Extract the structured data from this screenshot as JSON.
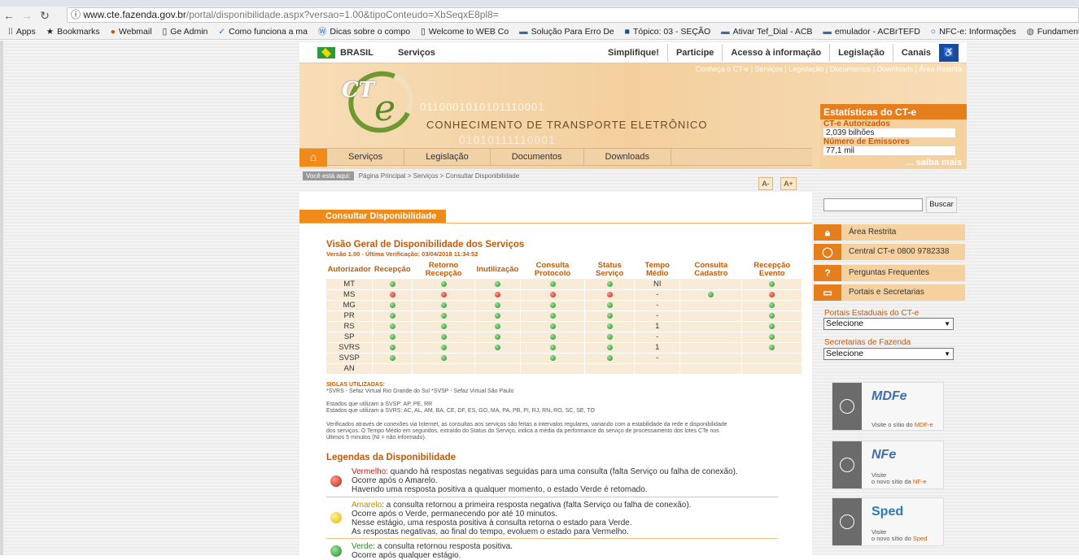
{
  "browser": {
    "url_host": "www.cte.fazenda.gov.br",
    "url_path": "/portal/disponibilidade.aspx?versao=1.00&tipoConteudo=XbSeqxE8pl8=",
    "bookmarks": [
      "Apps",
      "Bookmarks",
      "Webmail",
      "Ge Admin",
      "Como funciona a ma",
      "Dicas sobre o compo",
      "Welcome to WEB Co",
      "Solução Para Erro De",
      "Tópico: 03 - SEÇÃO",
      "Ativar Tef_Dial - ACB",
      "emulador - ACBrTEFD",
      "NFC-e: Informações",
      "Fundament"
    ]
  },
  "gov_bar": {
    "brasil": "BRASIL",
    "servicos": "Serviços",
    "items": [
      "Simplifique!",
      "Participe",
      "Acesso à informação",
      "Legislação",
      "Canais"
    ]
  },
  "header": {
    "top_links": "Conheça o CT-e | Serviços | Legislação | Documentos | Downloads | Área Restrita",
    "logo_ct": "CT",
    "logo_e": "e",
    "binary1": "0110001010101110001",
    "binary2": "01010111110001",
    "title": "CONHECIMENTO DE TRANSPORTE ELETRÔNICO"
  },
  "menu": [
    "Serviços",
    "Legislação",
    "Documentos",
    "Downloads"
  ],
  "stats": {
    "title": "Estatísticas do CT-e",
    "k1": "CT-e Autorizados",
    "v1": "2,039 bilhões",
    "k2": "Número de Emissores",
    "v2": "77,1 mil",
    "more": "... saiba mais"
  },
  "breadcrumb": {
    "label": "Você está aqui:",
    "path": "Página Principal > Serviços > Consultar Disponibilidade"
  },
  "font_buttons": {
    "minus": "A-",
    "plus": "A+"
  },
  "page_title": "Consultar Disponibilidade",
  "overview": {
    "title": "Visão Geral de Disponibilidade dos Serviços",
    "subtitle": "Versão 1.00 - Última Verificação: 03/04/2018 11:34:52"
  },
  "table": {
    "headers": [
      "Autorizador",
      "Recepção",
      "Retorno Recepção",
      "Inutilização",
      "Consulta Protocolo",
      "Status Serviço",
      "Tempo Médio",
      "Consulta Cadastro",
      "Recepção Evento"
    ],
    "rows": [
      {
        "name": "MT",
        "cells": [
          "g",
          "g",
          "g",
          "g",
          "g",
          "NI",
          "",
          "g"
        ]
      },
      {
        "name": "MS",
        "cells": [
          "r",
          "r",
          "r",
          "r",
          "r",
          "-",
          "g",
          "r"
        ]
      },
      {
        "name": "MG",
        "cells": [
          "g",
          "g",
          "g",
          "g",
          "g",
          "-",
          "",
          "g"
        ]
      },
      {
        "name": "PR",
        "cells": [
          "g",
          "g",
          "g",
          "g",
          "g",
          "-",
          "",
          "g"
        ]
      },
      {
        "name": "RS",
        "cells": [
          "g",
          "g",
          "g",
          "g",
          "g",
          "1",
          "",
          "g"
        ]
      },
      {
        "name": "SP",
        "cells": [
          "g",
          "g",
          "g",
          "g",
          "g",
          "-",
          "",
          "g"
        ]
      },
      {
        "name": "SVRS",
        "cells": [
          "g",
          "g",
          "g",
          "g",
          "g",
          "1",
          "",
          "g"
        ]
      },
      {
        "name": "SVSP",
        "cells": [
          "g",
          "g",
          "",
          "g",
          "g",
          "-",
          "",
          ""
        ]
      },
      {
        "name": "AN",
        "cells": [
          "",
          "",
          "",
          "",
          "",
          "",
          "",
          ""
        ]
      }
    ]
  },
  "siglas": {
    "title": "SIGLAS UTILIZADAS:",
    "text": "*SVRS - Sefaz Virtual Rio Grande do Sul *SVSP - Sefaz Virtual São Paulo",
    "svsp": "Estados que utilizam a SVSP: AP, PE, RR",
    "svrs": "Estados que utilizam a SVRS: AC, AL, AM, BA, CE, DF, ES, GO, MA, PA, PB, PI, RJ, RN, RO, SC, SE, TO",
    "note1": "Verificados através de conexões via Internet, as consultas aos serviços são feitas a intervalos regulares, variando com a estabilidade da rede e disponibilidade",
    "note2": "dos serviços. O Tempo Médio em segundos, extraído do Status do Serviço, indica a média da performance do serviço de processamento dos lotes CTe nos",
    "note3": "últimos 5 minutos (NI = não informado)."
  },
  "legend": {
    "title": "Legendas da Disponibilidade",
    "red": {
      "word": "Vermelho",
      "l1": ": quando há respostas negativas seguidas para uma consulta (falta Serviço ou falha de conexão).",
      "l2": "Ocorre após o Amarelo.",
      "l3": "Havendo uma resposta positiva a qualquer momento, o estado Verde é retomado."
    },
    "amber": {
      "word": "Amarelo",
      "l1": ": a consulta retornou a primeira resposta negativa (falta Serviço ou falha de conexão).",
      "l2": "Ocorre após o Verde, permanecendo por até 10 minutos.",
      "l3": " Nesse estágio, uma resposta positiva à consulta retorna o estado para Verde.",
      "l4": "As respostas negativas, ao final do tempo, evoluem o estado para Vermelho."
    },
    "green": {
      "word": "Verde",
      "l1": ": a consulta retornou resposta positiva.",
      "l2": "Ocorre após qualquer estágio."
    }
  },
  "sidebar": {
    "buscar": "Buscar",
    "items": [
      "Área Restrita",
      "Central CT-e 0800 9782338",
      "Perguntas Frequentes",
      "Portais e Secretarias"
    ],
    "portais_label": "Portais Estaduais do CT-e",
    "portais_value": "Selecione",
    "secretarias_label": "Secretarias de Fazenda",
    "secretarias_value": "Selecione",
    "banners": [
      {
        "logo": "MDFe",
        "l1": "Visite o sítio do ",
        "l2": "MDF-e"
      },
      {
        "logo": "NFe",
        "l1": "Visite",
        "l2": "o novo sítio da ",
        "l3": "NF-e"
      },
      {
        "logo": "Sped",
        "l1": "Visite",
        "l2": "o novo sítio do ",
        "l3": "Sped"
      }
    ]
  }
}
